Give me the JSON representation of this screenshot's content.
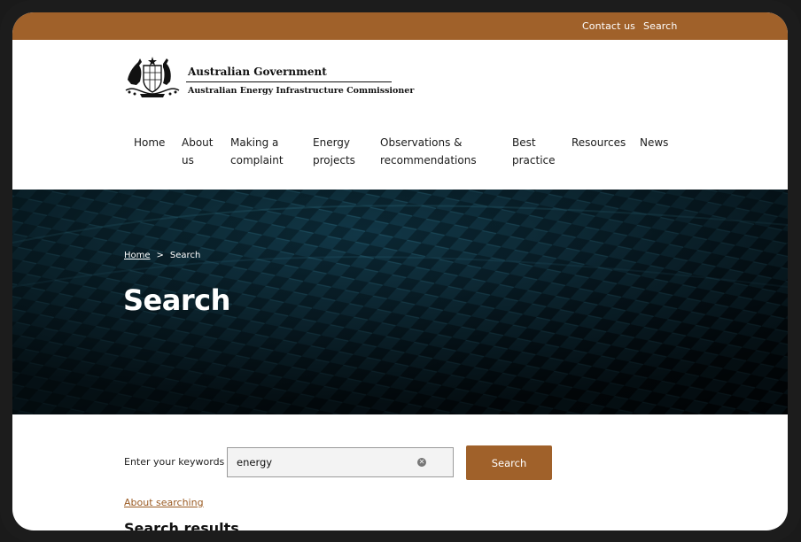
{
  "utility_bar": {
    "contact_label": "Contact us",
    "search_label": "Search",
    "color": "#a0612a"
  },
  "logo": {
    "government": "Australian Government",
    "agency": "Australian Energy Infrastructure Commissioner"
  },
  "nav": {
    "items": [
      {
        "line1": "Home",
        "line2": ""
      },
      {
        "line1": "About",
        "line2": "us"
      },
      {
        "line1": "Making a",
        "line2": "complaint"
      },
      {
        "line1": "Energy",
        "line2": "projects"
      },
      {
        "line1": "Observations &",
        "line2": "recommendations"
      },
      {
        "line1": "Best",
        "line2": "practice"
      },
      {
        "line1": "Resources",
        "line2": ""
      },
      {
        "line1": "News",
        "line2": ""
      }
    ]
  },
  "hero": {
    "breadcrumb": {
      "home": "Home",
      "separator": ">",
      "current": "Search"
    },
    "title": "Search"
  },
  "search_form": {
    "label": "Enter your keywords",
    "value": "energy",
    "clear_icon": "clear-icon",
    "button_label": "Search",
    "about_link": "About searching"
  },
  "results": {
    "heading": "Search results"
  }
}
